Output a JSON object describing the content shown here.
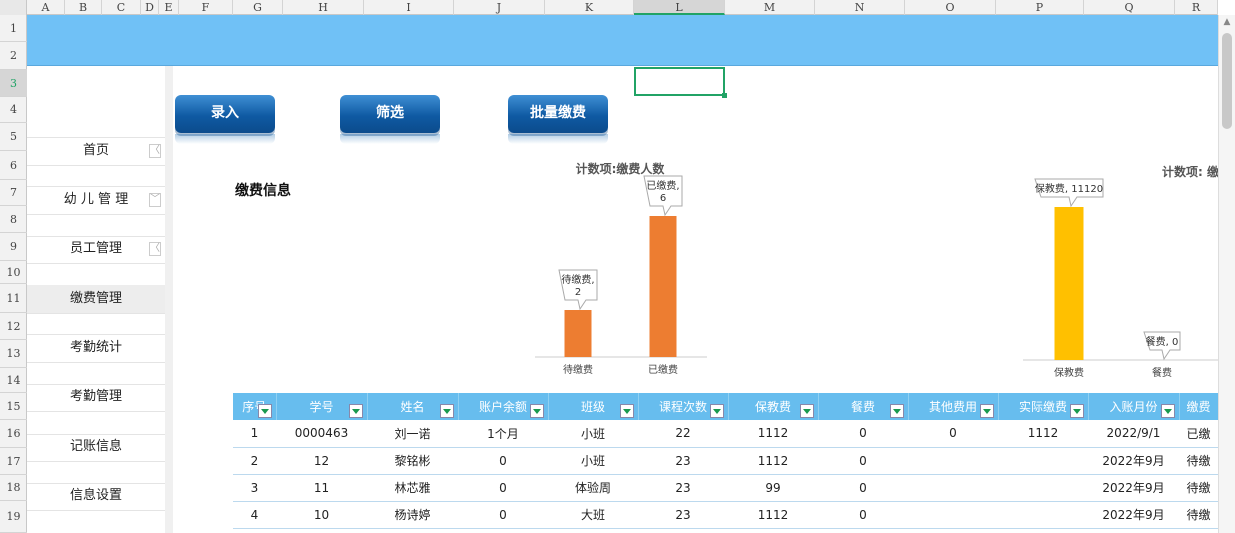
{
  "columns": [
    "A",
    "B",
    "C",
    "D",
    "E",
    "F",
    "G",
    "H",
    "I",
    "J",
    "K",
    "L",
    "M",
    "N",
    "O",
    "P",
    "Q",
    "R"
  ],
  "rows": [
    "1",
    "2",
    "3",
    "4",
    "5",
    "6",
    "7",
    "8",
    "9",
    "10",
    "11",
    "12",
    "13",
    "14",
    "15",
    "16",
    "17",
    "18",
    "19"
  ],
  "buttons": {
    "entry": "录入",
    "filter": "筛选",
    "batch_pay": "批量缴费"
  },
  "nav": [
    {
      "label": "首页",
      "arrow": "〈"
    },
    {
      "label": "幼 儿 管 理",
      "arrow": "﹀"
    },
    {
      "label": "员工管理",
      "arrow": "〈"
    },
    {
      "label": "缴费管理",
      "arrow": ""
    },
    {
      "label": "考勤统计",
      "arrow": ""
    },
    {
      "label": "考勤管理",
      "arrow": ""
    },
    {
      "label": "记账信息",
      "arrow": ""
    },
    {
      "label": "信息设置",
      "arrow": ""
    }
  ],
  "panel_title": "缴费信息",
  "chart_data": [
    {
      "type": "bar",
      "title": "计数项:缴费人数",
      "categories": [
        "待缴费",
        "已缴费"
      ],
      "values": [
        2,
        6
      ],
      "data_labels": [
        "待缴费,\n2",
        "已缴费,\n6"
      ],
      "color": "#ed7d31"
    },
    {
      "type": "bar",
      "title": "计数项: 缴",
      "categories": [
        "保教费",
        "餐费"
      ],
      "values": [
        11120,
        0
      ],
      "data_labels": [
        "保教费, 11120",
        "餐费, 0"
      ],
      "color": "#ffc000"
    }
  ],
  "table": {
    "headers": [
      "序号",
      "学号",
      "姓名",
      "账户余额",
      "班级",
      "课程次数",
      "保教费",
      "餐费",
      "其他费用",
      "实际缴费",
      "入账月份",
      "缴费"
    ],
    "rows": [
      [
        "1",
        "0000463",
        "刘一诺",
        "1个月",
        "小班",
        "22",
        "1112",
        "0",
        "0",
        "1112",
        "2022/9/1",
        "已缴"
      ],
      [
        "2",
        "12",
        "黎铭彬",
        "0",
        "小班",
        "23",
        "1112",
        "0",
        "",
        "",
        "2022年9月",
        "待缴"
      ],
      [
        "3",
        "11",
        "林芯雅",
        "0",
        "体验周",
        "23",
        "99",
        "0",
        "",
        "",
        "2022年9月",
        "待缴"
      ],
      [
        "4",
        "10",
        "杨诗婷",
        "0",
        "大班",
        "23",
        "1112",
        "0",
        "",
        "",
        "2022年9月",
        "待缴"
      ]
    ]
  }
}
